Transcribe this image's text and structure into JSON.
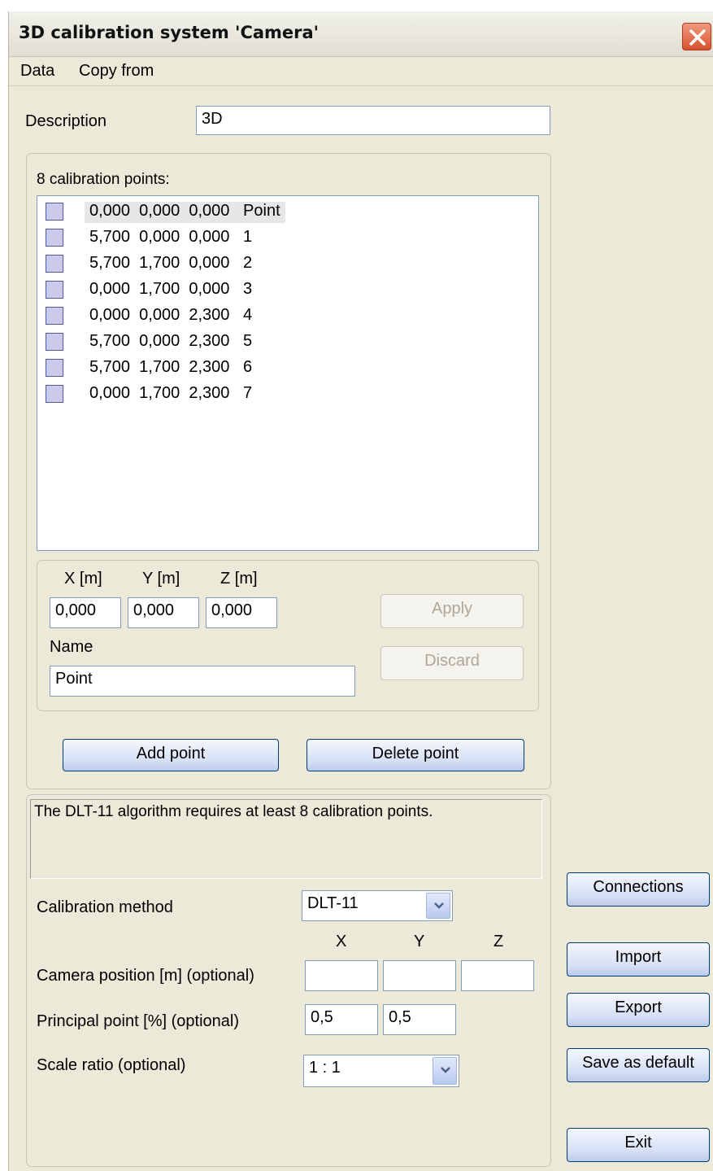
{
  "window": {
    "title": "3D calibration system 'Camera'"
  },
  "menu": {
    "items": [
      "Data",
      "Copy from"
    ]
  },
  "description": {
    "label": "Description",
    "value": "3D"
  },
  "points": {
    "count_label": "8 calibration points:",
    "rows": [
      "0,000  0,000  0,000   Point",
      "5,700  0,000  0,000   1",
      "5,700  1,700  0,000   2",
      "0,000  1,700  0,000   3",
      "0,000  0,000  2,300   4",
      "5,700  0,000  2,300   5",
      "5,700  1,700  2,300   6",
      "0,000  1,700  2,300   7"
    ]
  },
  "editor": {
    "x_label": "X [m]",
    "y_label": "Y [m]",
    "z_label": "Z [m]",
    "x_value": "0,000",
    "y_value": "0,000",
    "z_value": "0,000",
    "name_label": "Name",
    "name_value": "Point",
    "apply_label": "Apply",
    "discard_label": "Discard"
  },
  "actions": {
    "add_point": "Add point",
    "delete_point": "Delete point"
  },
  "message": "The DLT-11 algorithm requires at least 8 calibration points.",
  "settings": {
    "method_label": "Calibration method",
    "method_value": "DLT-11",
    "col_x": "X",
    "col_y": "Y",
    "col_z": "Z",
    "camera_label": "Camera position [m] (optional)",
    "camera_x": "",
    "camera_y": "",
    "camera_z": "",
    "principal_label": "Principal point [%] (optional)",
    "principal_x": "0,5",
    "principal_y": "0,5",
    "scale_label": "Scale ratio (optional)",
    "scale_value": "1 : 1"
  },
  "side_buttons": {
    "connections": "Connections",
    "import": "Import",
    "export": "Export",
    "save_default": "Save as default",
    "exit": "Exit"
  },
  "colors": {
    "close_button": "#d7512f",
    "window_bg": "#ece9d8",
    "selected_row": "#e6e6e6"
  }
}
